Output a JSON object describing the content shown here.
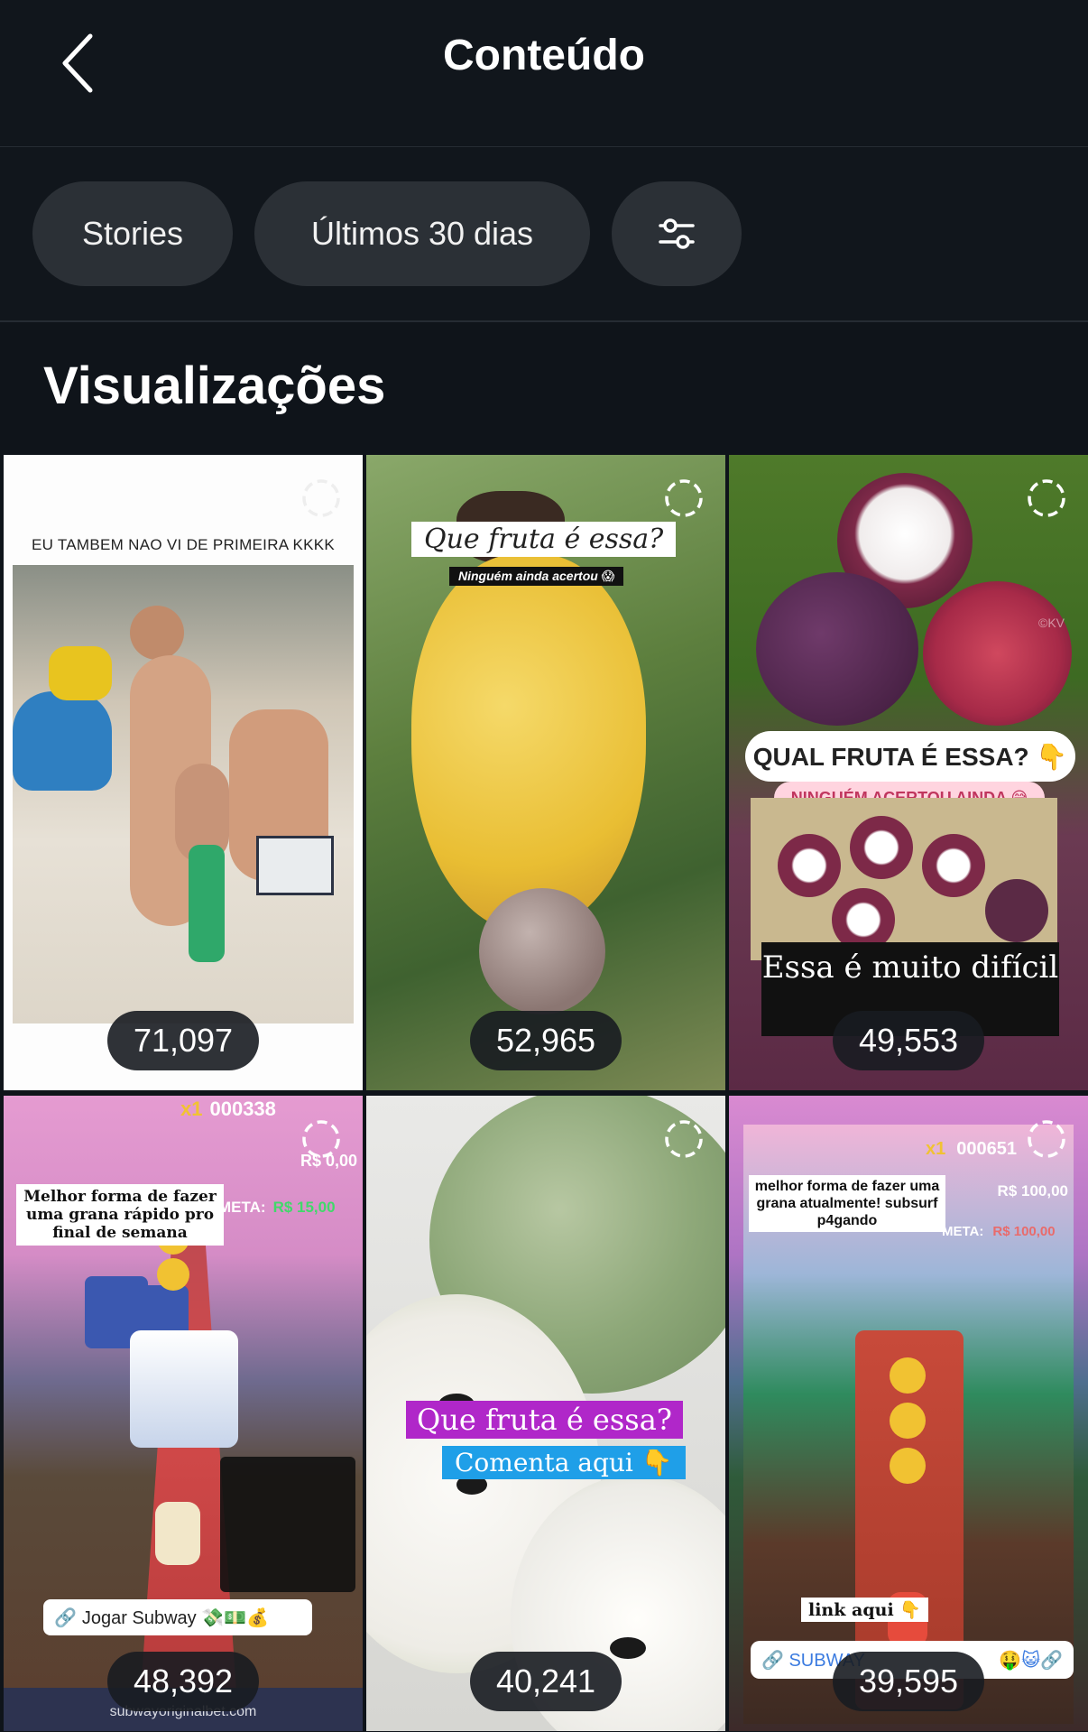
{
  "header": {
    "title": "Conteúdo"
  },
  "filters": {
    "type_chip": "Stories",
    "period_chip": "Últimos 30 dias"
  },
  "section": {
    "title": "Visualizações"
  },
  "tiles": [
    {
      "caption": "EU TAMBEM NAO VI DE PRIMEIRA KKKK",
      "views": "71,097"
    },
    {
      "caption": "Que fruta é essa?",
      "subcaption": "Ninguém ainda acertou 😱",
      "views": "52,965"
    },
    {
      "caption": "QUAL FRUTA É ESSA? 👇",
      "subcaption": "NINGUÉM ACERTOU AINDA 😅",
      "caption2": "Essa é muito difícil",
      "watermark": "©KV",
      "views": "49,553"
    },
    {
      "caption": "Melhor forma de fazer uma grana rápido pro final de semana",
      "multiplier": "x1",
      "score": "000338",
      "money": "R$ 0,00",
      "meta_label": "META:",
      "meta_value": "R$ 15,00",
      "button": "Jogar Subway 💸💵💰",
      "url": "subwayoriginalbet.com",
      "views": "48,392"
    },
    {
      "caption": "Que fruta é essa?",
      "subcaption": "Comenta aqui 👇",
      "views": "40,241"
    },
    {
      "caption": "melhor forma de fazer uma grana atualmente! subsurf p4gando",
      "multiplier": "x1",
      "score": "000651",
      "money": "R$ 100,00",
      "meta_label": "META:",
      "meta_value": "R$ 100,00",
      "link": "link aqui 👇",
      "button": "SUBWAY",
      "emoji": "🤑😺🔗",
      "views": "39,595"
    }
  ]
}
